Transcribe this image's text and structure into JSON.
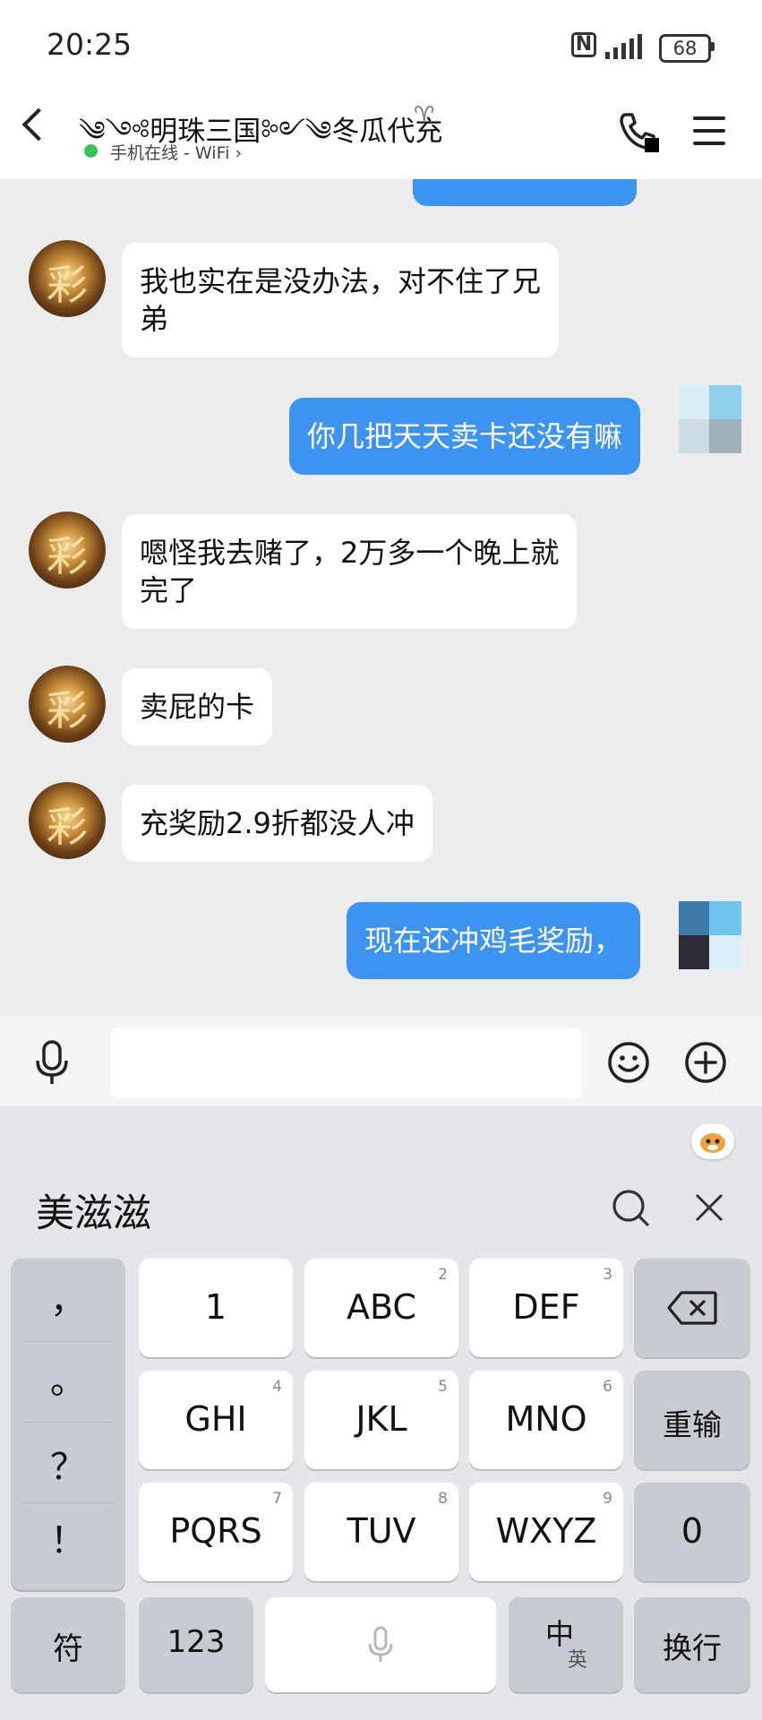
{
  "status_bar": {
    "time": "20:25",
    "nfc": "N",
    "battery": "68"
  },
  "header": {
    "title": "༄༺明珠三国༻༄冬瓜代充",
    "status": "手机在线 - WiFi ›"
  },
  "messages": [
    {
      "side": "in",
      "lines": [
        "我也实在是没办法，对不住了兄",
        "弟"
      ]
    },
    {
      "side": "out",
      "lines": [
        "你几把天天卖卡还没有嘛"
      ]
    },
    {
      "side": "in",
      "lines": [
        "嗯怪我去赌了，2万多一个晚上就",
        "完了"
      ]
    },
    {
      "side": "in",
      "lines": [
        "卖屁的卡"
      ]
    },
    {
      "side": "in",
      "lines": [
        "充奖励2.9折都没人冲"
      ]
    },
    {
      "side": "out",
      "lines": [
        "现在还冲鸡毛奖励，"
      ]
    }
  ],
  "ime": {
    "candidate": "美滋滋",
    "punct": [
      "，",
      "。",
      "？",
      "！"
    ],
    "keys": {
      "k1": {
        "main": "1",
        "sub": ""
      },
      "k2": {
        "main": "ABC",
        "sub": "2"
      },
      "k3": {
        "main": "DEF",
        "sub": "3"
      },
      "k4": {
        "main": "GHI",
        "sub": "4"
      },
      "k5": {
        "main": "JKL",
        "sub": "5"
      },
      "k6": {
        "main": "MNO",
        "sub": "6"
      },
      "k7": {
        "main": "PQRS",
        "sub": "7"
      },
      "k8": {
        "main": "TUV",
        "sub": "8"
      },
      "k9": {
        "main": "WXYZ",
        "sub": "9"
      },
      "reinput": "重输",
      "zero": "0",
      "symbol": "符",
      "num": "123",
      "lang_main": "中",
      "lang_sub": "英",
      "enter": "换行"
    }
  },
  "colors": {
    "bubble_out": "#3d94f0",
    "bubble_in": "#ffffff",
    "online": "#36c45a"
  },
  "icons": [
    "back-icon",
    "ear-icon",
    "phone-icon",
    "menu-icon",
    "mic-icon",
    "emoji-icon",
    "plus-icon",
    "search-icon",
    "close-icon",
    "backspace-icon",
    "voice-mic-icon"
  ]
}
